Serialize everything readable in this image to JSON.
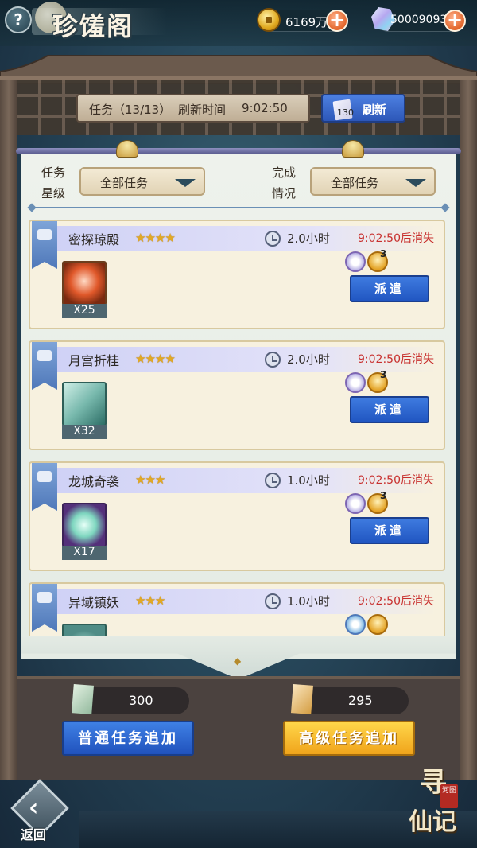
{
  "header": {
    "title": "珍馐阁",
    "help_label": "?",
    "coins": "6169万",
    "gems": "50009093",
    "plus_label": "+"
  },
  "task_bar": {
    "label": "任务（13/13）",
    "refresh_time_label": "刷新时间",
    "refresh_time": "9:02:50",
    "refresh_button_label": "刷新",
    "refresh_cost": "130"
  },
  "filters": {
    "star_label_line1": "任务",
    "star_label_line2": "星级",
    "star_value": "全部任务",
    "status_label_line1": "完成",
    "status_label_line2": "情况",
    "status_value": "全部任务"
  },
  "tasks": [
    {
      "name": "密探琼殿",
      "stars": "★★★★",
      "duration": "2.0小时",
      "expire": "9:02:50后消失",
      "reward_qty": "X25",
      "hint_count": "3",
      "button_label": "派遣"
    },
    {
      "name": "月宫折桂",
      "stars": "★★★★",
      "duration": "2.0小时",
      "expire": "9:02:50后消失",
      "reward_qty": "X32",
      "hint_count": "3",
      "button_label": "派遣"
    },
    {
      "name": "龙城奇袭",
      "stars": "★★★",
      "duration": "1.0小时",
      "expire": "9:02:50后消失",
      "reward_qty": "X17",
      "hint_count": "3",
      "button_label": "派遣"
    },
    {
      "name": "异域镇妖",
      "stars": "★★★",
      "duration": "1.0小时",
      "expire": "9:02:50后消失",
      "reward_qty": "",
      "hint_count": "",
      "button_label": ""
    }
  ],
  "bottom": {
    "normal_ticket_count": "300",
    "advanced_ticket_count": "295",
    "normal_add_label": "普通任务追加",
    "advanced_add_label": "高级任务追加",
    "back_label": "返回",
    "back_icon": "back-arrow-icon"
  },
  "logo": {
    "text_line1": "寻",
    "text_line2": "仙记",
    "seal": "河图"
  },
  "colors": {
    "expire_red": "#c8302e",
    "button_blue": "#2d57b8",
    "button_gold": "#f0a41b",
    "star_gold": "#e3a923"
  }
}
